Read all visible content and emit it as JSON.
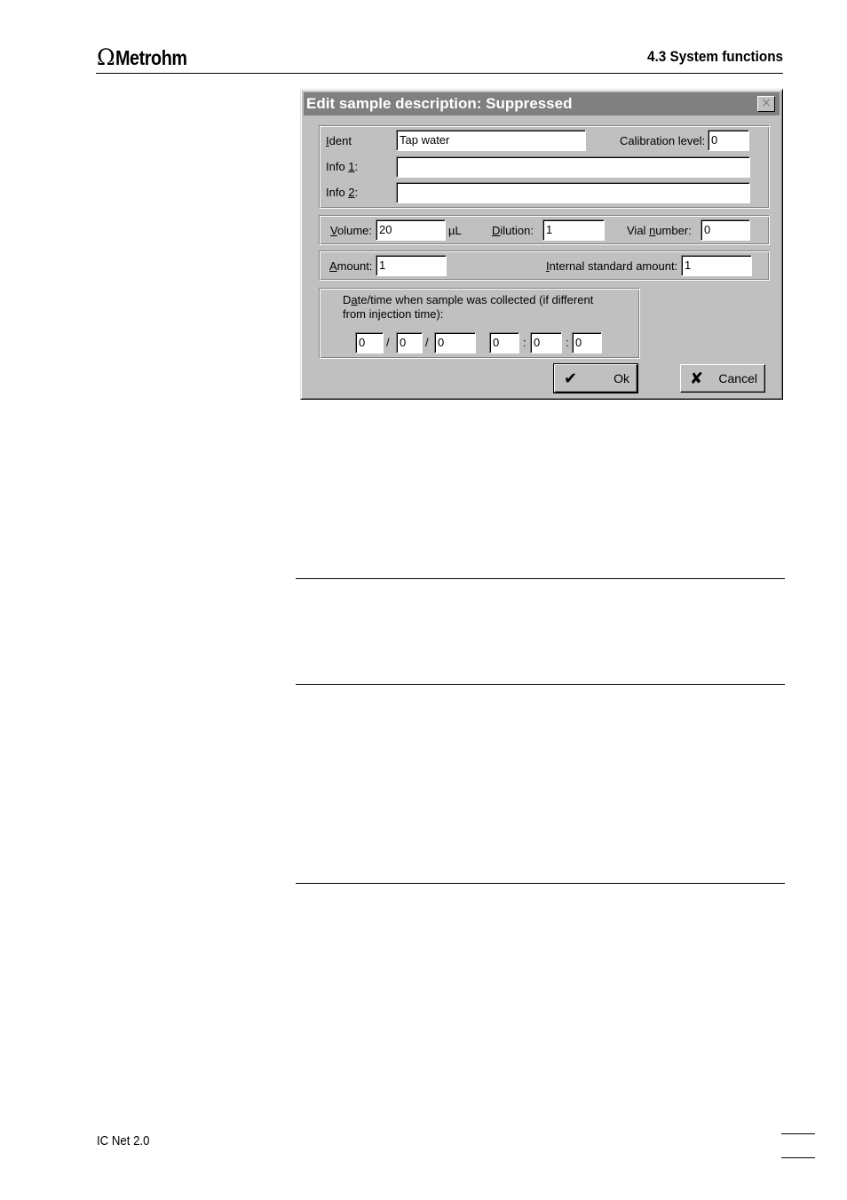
{
  "header": {
    "logo_symbol": "Ω",
    "brand": "Metrohm",
    "section": "4.3  System functions"
  },
  "dialog": {
    "title": "Edit sample description: Suppressed",
    "close_glyph": "×",
    "labels": {
      "ident_u": "I",
      "ident_rest": "dent",
      "calibration_level": "Calibration level:",
      "info1_pre": "Info ",
      "info1_u": "1",
      "info1_post": ":",
      "info2_pre": "Info ",
      "info2_u": "2",
      "info2_post": ":",
      "volume_u": "V",
      "volume_rest": "olume:",
      "volume_unit": "µL",
      "dilution_u": "D",
      "dilution_rest": "ilution:",
      "vial_pre": "Vial ",
      "vial_u": "n",
      "vial_rest": "umber:",
      "amount_u": "A",
      "amount_rest": "mount:",
      "internal_u": "I",
      "internal_rest": "nternal standard amount:",
      "date_line1_pre": "D",
      "date_line1_u": "a",
      "date_line1_rest": "te/time when sample was collected (if different",
      "date_line2": "from injection time):"
    },
    "values": {
      "ident": "Tap water",
      "calibration_level": "0",
      "info1": "",
      "info2": "",
      "volume": "20",
      "dilution": "1",
      "vial_number": "0",
      "amount": "1",
      "internal_standard_amount": "1",
      "date_month": "0",
      "date_day": "0",
      "date_year": "0",
      "time_hour": "0",
      "time_minute": "0",
      "time_second": "0"
    },
    "separators": {
      "date": "/",
      "time": ":"
    },
    "buttons": {
      "ok_icon": "✔",
      "ok": "Ok",
      "cancel_icon": "✘",
      "cancel": "Cancel"
    }
  },
  "footer": {
    "product": "IC Net 2.0"
  }
}
